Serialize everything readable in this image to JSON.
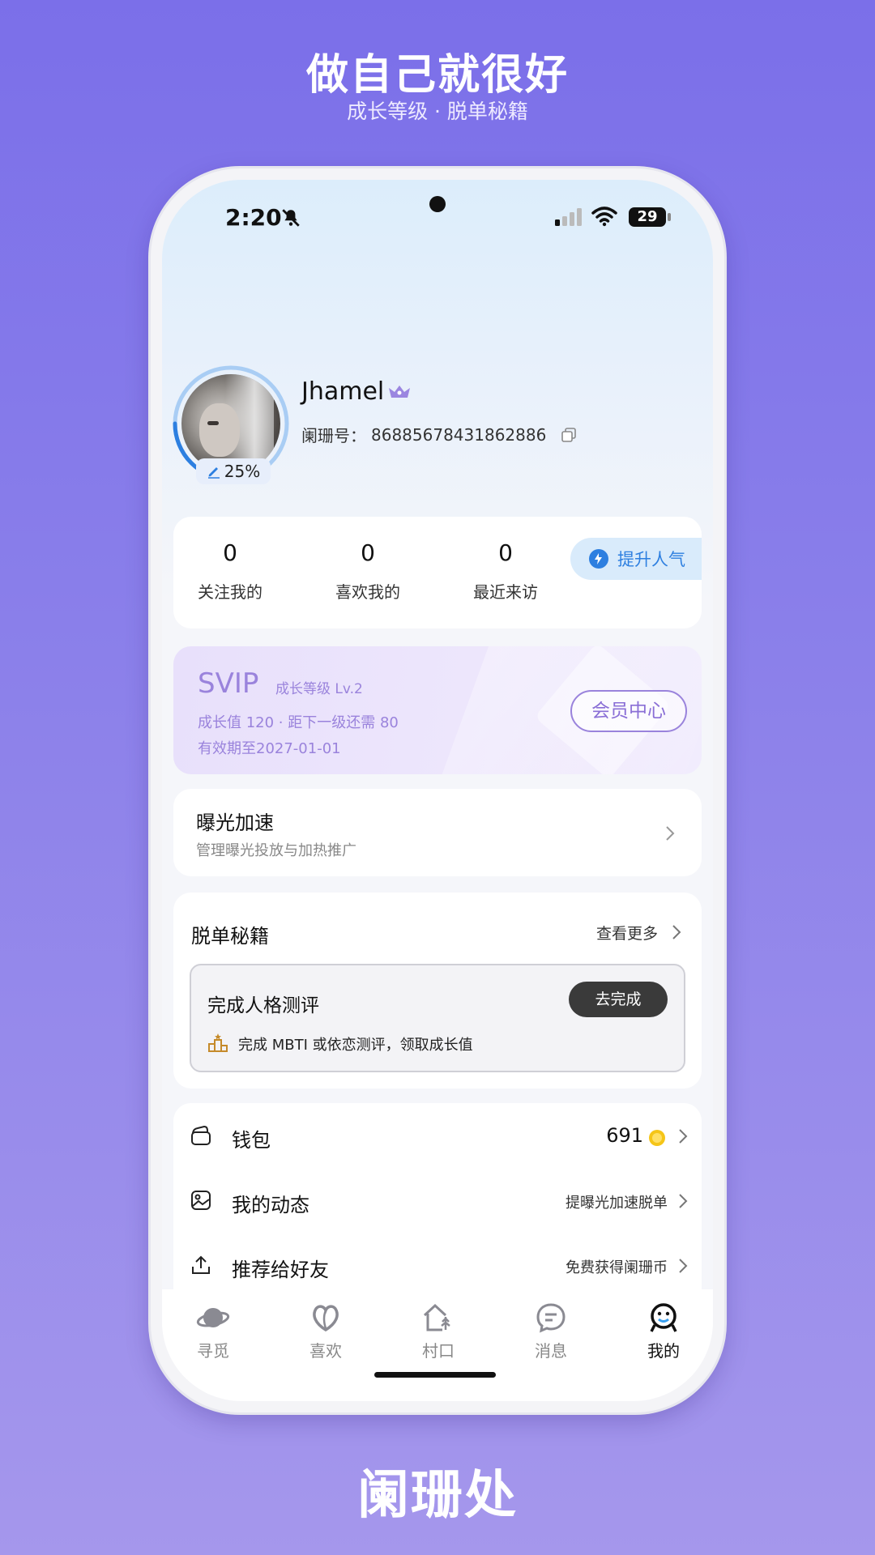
{
  "promo": {
    "headline": "做自己就很好",
    "subhead": "成长等级 · 脱单秘籍",
    "brand": "阑珊处"
  },
  "status_bar": {
    "time": "2:20",
    "battery": "29"
  },
  "profile": {
    "username": "Jhamel",
    "id_label": "阑珊号：",
    "id_value": "86885678431862886",
    "completion": "25%",
    "completion_value": 0.25
  },
  "stats": [
    {
      "value": "0",
      "label": "关注我的"
    },
    {
      "value": "0",
      "label": "喜欢我的"
    },
    {
      "value": "0",
      "label": "最近来访"
    }
  ],
  "boost_button": "提升人气",
  "vip": {
    "title": "SVIP",
    "level": "成长等级 Lv.2",
    "growth": "成长值 120 · 距下一级还需 80",
    "expiry": "有效期至2027-01-01",
    "center_button": "会员中心"
  },
  "exposure": {
    "title": "曝光加速",
    "subtitle": "管理曝光投放与加热推广"
  },
  "secrets": {
    "title": "脱单秘籍",
    "more": "查看更多",
    "task_title": "完成人格测评",
    "task_button": "去完成",
    "task_desc": "完成 MBTI 或依恋测评，领取成长值"
  },
  "menu": [
    {
      "icon": "wallet-icon",
      "label": "钱包",
      "value": "691"
    },
    {
      "icon": "gallery-icon",
      "label": "我的动态",
      "value": "提曝光加速脱单"
    },
    {
      "icon": "share-icon",
      "label": "推荐给好友",
      "value": "免费获得阑珊币"
    }
  ],
  "tabs": [
    {
      "icon": "planet-icon",
      "label": "寻觅"
    },
    {
      "icon": "heart-leaf-icon",
      "label": "喜欢"
    },
    {
      "icon": "village-icon",
      "label": "村口"
    },
    {
      "icon": "message-icon",
      "label": "消息"
    },
    {
      "icon": "me-icon",
      "label": "我的",
      "active": true
    }
  ],
  "colors": {
    "background": "#7b6fe9",
    "accent_blue": "#2d7fe0",
    "vip_purple": "#9a83dc"
  }
}
